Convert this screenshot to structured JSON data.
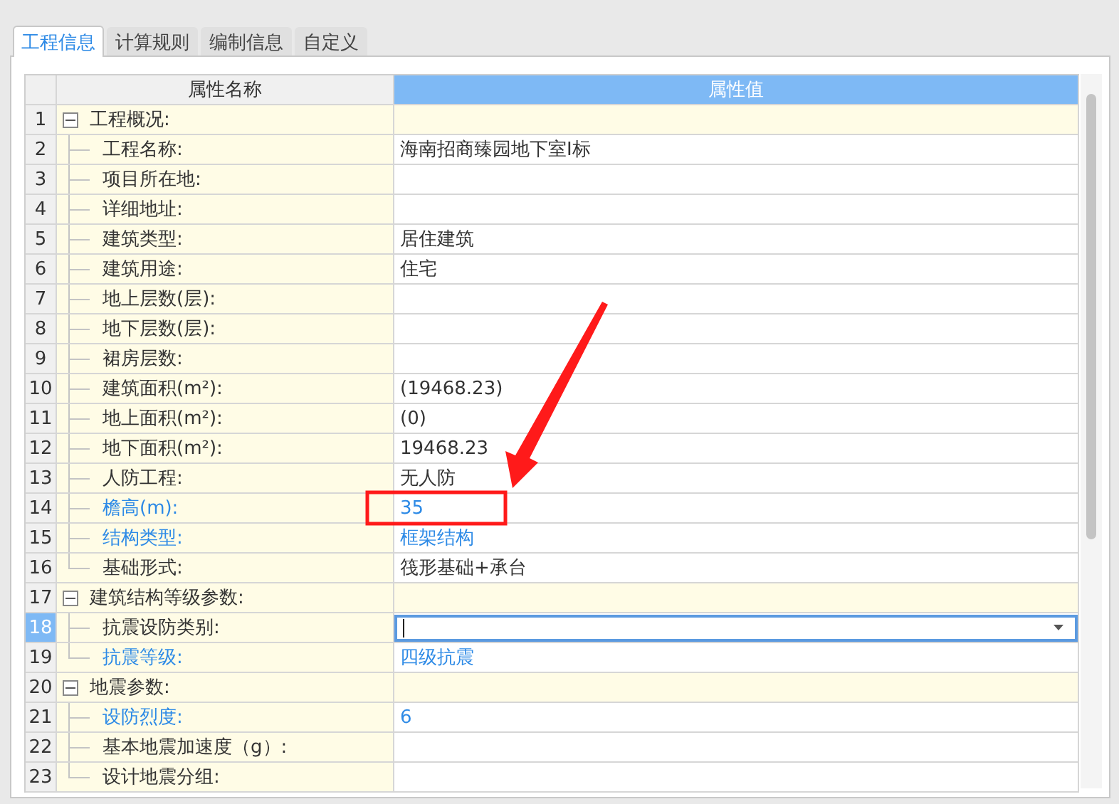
{
  "tabs": [
    {
      "label": "工程信息",
      "selected": true
    },
    {
      "label": "计算规则",
      "selected": false
    },
    {
      "label": "编制信息",
      "selected": false
    },
    {
      "label": "自定义",
      "selected": false
    }
  ],
  "table": {
    "columns": [
      "属性名称",
      "属性值"
    ],
    "groups": [
      {
        "number": "1",
        "name": "工程概况:",
        "expanded": true,
        "children": [
          {
            "number": "2",
            "name": "工程名称:",
            "value": "海南招商臻园地下室I标",
            "modified": false,
            "selected": false
          },
          {
            "number": "3",
            "name": "项目所在地:",
            "modified": false,
            "selected": false
          },
          {
            "number": "4",
            "name": "详细地址:",
            "modified": false,
            "selected": false
          },
          {
            "number": "5",
            "name": "建筑类型:",
            "value": "居住建筑",
            "modified": false,
            "selected": false
          },
          {
            "number": "6",
            "name": "建筑用途:",
            "value": "住宅",
            "modified": false,
            "selected": false
          },
          {
            "number": "7",
            "name": "地上层数(层):",
            "modified": false,
            "selected": false
          },
          {
            "number": "8",
            "name": "地下层数(层):",
            "modified": false,
            "selected": false
          },
          {
            "number": "9",
            "name": "裙房层数:",
            "modified": false,
            "selected": false
          },
          {
            "number": "10",
            "name": "建筑面积(m²):",
            "value": "(19468.23)",
            "modified": false,
            "selected": false
          },
          {
            "number": "11",
            "name": "地上面积(m²):",
            "value": "(0)",
            "modified": false,
            "selected": false
          },
          {
            "number": "12",
            "name": "地下面积(m²):",
            "value": "19468.23",
            "modified": false,
            "selected": false
          },
          {
            "number": "13",
            "name": "人防工程:",
            "value": "无人防",
            "modified": false,
            "selected": false
          },
          {
            "number": "14",
            "name": "檐高(m):",
            "value": "35",
            "modified": true,
            "selected": false
          },
          {
            "number": "15",
            "name": "结构类型:",
            "value": "框架结构",
            "modified": true,
            "selected": false
          },
          {
            "number": "16",
            "name": "基础形式:",
            "value": "筏形基础+承台",
            "modified": false,
            "selected": false
          }
        ]
      },
      {
        "number": "17",
        "name": "建筑结构等级参数:",
        "expanded": true,
        "children": [
          {
            "number": "18",
            "name": "抗震设防类别:",
            "modified": false,
            "selected": true
          },
          {
            "number": "19",
            "name": "抗震等级:",
            "value": "四级抗震",
            "modified": true,
            "selected": false
          }
        ]
      },
      {
        "number": "20",
        "name": "地震参数:",
        "expanded": true,
        "children": [
          {
            "number": "21",
            "name": "设防烈度:",
            "value": "6",
            "modified": true,
            "selected": false
          },
          {
            "number": "22",
            "name": "基本地震加速度（g）:",
            "modified": false,
            "selected": false
          },
          {
            "number": "23",
            "name": "设计地震分组:",
            "modified": false,
            "selected": false
          }
        ]
      }
    ]
  }
}
